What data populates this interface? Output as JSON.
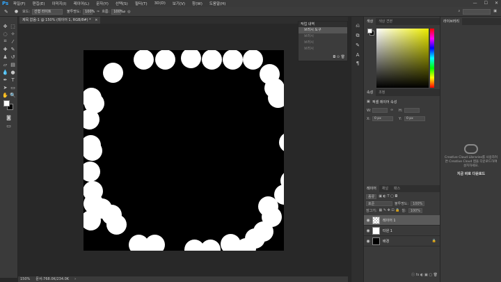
{
  "menubar": {
    "logo": "Ps",
    "items": [
      "파일(F)",
      "편집(E)",
      "이미지(I)",
      "레이어(L)",
      "문자(Y)",
      "선택(S)",
      "필터(T)",
      "3D(D)",
      "보기(V)",
      "창(W)",
      "도움말(H)"
    ],
    "window_buttons": [
      "—",
      "☐",
      "✕"
    ]
  },
  "options": {
    "brush_size": "●",
    "mode_label": "모드:",
    "mode_value": "선형 라이트",
    "opacity_label": "불투명도:",
    "opacity_value": "100%",
    "flow_label": "흐름:",
    "flow_value": "100%"
  },
  "document": {
    "tab_title": "제목 없음-1 @ 150% (레이어 1, RGB/8#) *",
    "tab_close": "×",
    "zoom": "150%",
    "doc_info": "문서:768.0K/234.0K",
    "status_arrow": "›"
  },
  "history": {
    "title": "작업 내역",
    "items": [
      "브러시 도구",
      "브러시",
      "브러시",
      "브러시"
    ],
    "footer": "◘ ⊙ 🗑"
  },
  "color_panel": {
    "tabs": [
      "색상",
      "색상 견본"
    ],
    "accent": "#eded00"
  },
  "properties_panel": {
    "tabs": [
      "속성",
      "조정"
    ],
    "title": "픽셀 레이어 속성",
    "w_label": "W:",
    "h_label": "H:",
    "x_label": "X:",
    "y_label": "Y:",
    "x_value": "0 px",
    "y_value": "0 px"
  },
  "layers_panel": {
    "tabs": [
      "레이어",
      "채널",
      "패스"
    ],
    "kind_label": "종류",
    "blend_label": "표준",
    "opacity_label": "불투명도:",
    "opacity_value": "100%",
    "lock_label": "잠그기:",
    "fill_label": "칠:",
    "fill_value": "100%",
    "layers": [
      {
        "name": "레이어 1",
        "selected": true
      },
      {
        "name": "타원 1",
        "selected": false
      },
      {
        "name": "배경",
        "selected": false
      }
    ],
    "footer_icons": "ⓛ fx ◐ ▣ ▢ 🗑"
  },
  "library_panel": {
    "tab": "라이브러리",
    "message": "Creative Cloud Libraries를 사용하려면 Creative Cloud 앱을 다운로드하여 설치하세요.",
    "download_link": "지금 바로 다운로드"
  }
}
